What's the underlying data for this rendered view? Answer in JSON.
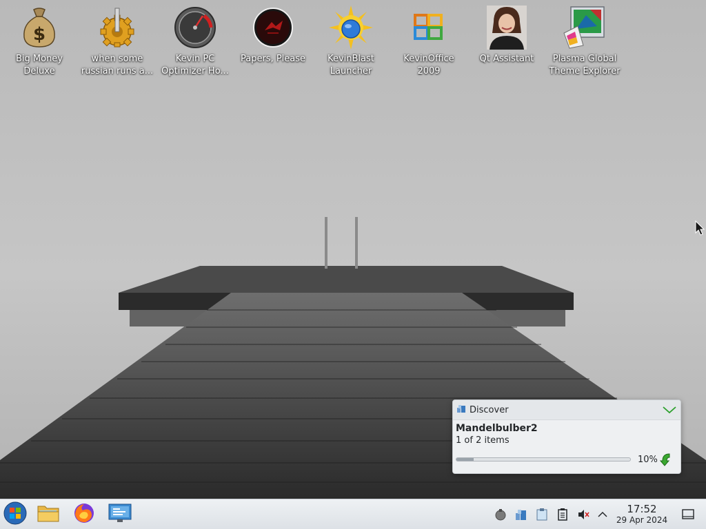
{
  "desktop": {
    "icons": [
      {
        "label": "Big Money\nDeluxe",
        "icon": "money-bag-icon"
      },
      {
        "label": "when some\nrussian runs a...",
        "icon": "gear-icon"
      },
      {
        "label": "Kevin PC\nOptimizer Ho...",
        "icon": "gauge-icon"
      },
      {
        "label": "Papers, Please",
        "icon": "seal-icon"
      },
      {
        "label": "KevinBlast\nLauncher",
        "icon": "sun-disc-icon"
      },
      {
        "label": "KevinOffice\n2009",
        "icon": "office-logo-icon"
      },
      {
        "label": "Qt Assistant",
        "icon": "person-photo-icon"
      },
      {
        "label": "Plasma Global\nTheme Explorer",
        "icon": "theme-monitor-icon"
      }
    ]
  },
  "notification": {
    "app_name": "Discover",
    "title": "Mandelbulber2",
    "subtitle": "1 of 2 items",
    "progress_percent": 10,
    "progress_label": "10%"
  },
  "taskbar": {
    "launchers": [
      {
        "name": "start-menu-button",
        "icon": "start-orb-icon"
      },
      {
        "name": "file-manager-button",
        "icon": "folder-icon"
      },
      {
        "name": "firefox-button",
        "icon": "firefox-icon"
      },
      {
        "name": "system-settings-button",
        "icon": "settings-monitor-icon"
      }
    ],
    "tray": [
      "updates-icon",
      "discover-tray-icon",
      "clipboard-icon",
      "notes-icon",
      "volume-muted-icon",
      "expand-tray-icon"
    ],
    "clock": {
      "time": "17:52",
      "date": "29 Apr 2024"
    }
  },
  "colors": {
    "accent_green": "#2ca02c",
    "panel_bg": "#e8ebee"
  }
}
